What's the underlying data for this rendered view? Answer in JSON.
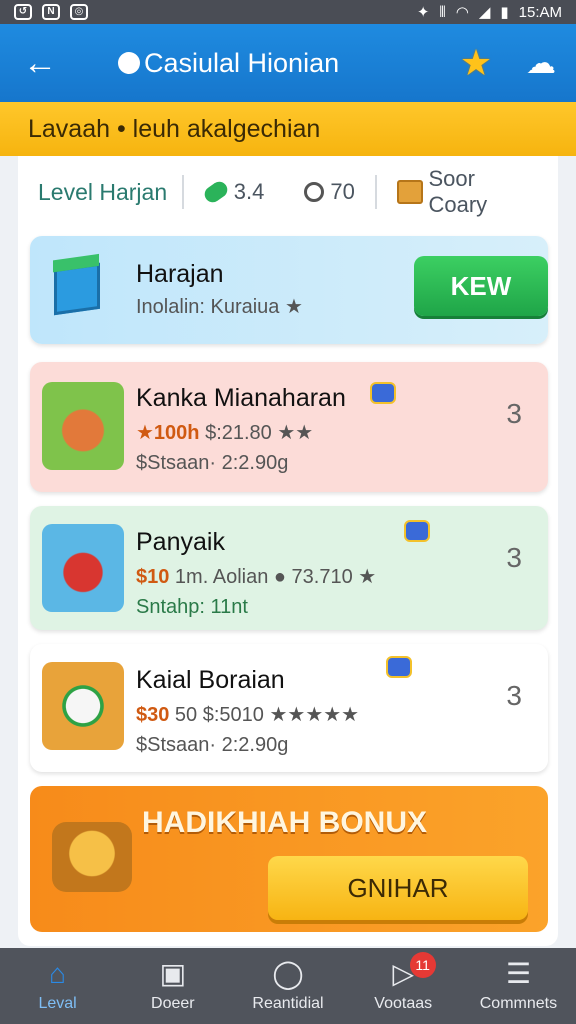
{
  "status_bar": {
    "time": "15:AM"
  },
  "app_bar": {
    "title": "Casiulal Hionian"
  },
  "banner": {
    "text": "Lavaah • leuh akalgechian"
  },
  "info_bar": {
    "level_label": "Level Harjan",
    "stat1": "3.4",
    "stat2": "70",
    "stat3": "Soor Coary"
  },
  "cards": [
    {
      "name": "Harajan",
      "subtitle": "Inolalin: Kuraiua ★",
      "button": "KEW"
    },
    {
      "name": "Kanka Mianaharan",
      "sub_a_hl": "★100h",
      "sub_a_rest": " $:21.80 ★★",
      "sub_b": "$Stsaan· 2:2.90g",
      "rank": "3"
    },
    {
      "name": "Panyaik",
      "sub_a_hl": "$10",
      "sub_a_rest": " 1m. Aolian ● 73.710 ★",
      "sub_b": "Sntahp: 11nt",
      "rank": "3"
    },
    {
      "name": "Kaial Boraian",
      "sub_a_hl": "$30",
      "sub_a_rest": " 50 $:5010 ★★★★★",
      "sub_b": "$Stsaan· 2:2.90g",
      "rank": "3"
    }
  ],
  "bonus": {
    "title": "HADIKHIAH BONUX",
    "button": "GNIHAR"
  },
  "bottom_nav": [
    {
      "label": "Leval",
      "icon": "home-icon"
    },
    {
      "label": "Doeer",
      "icon": "screen-icon"
    },
    {
      "label": "Reantidial",
      "icon": "ring-icon"
    },
    {
      "label": "Vootaas",
      "icon": "video-icon",
      "badge": "11"
    },
    {
      "label": "Commnets",
      "icon": "stack-icon"
    }
  ]
}
